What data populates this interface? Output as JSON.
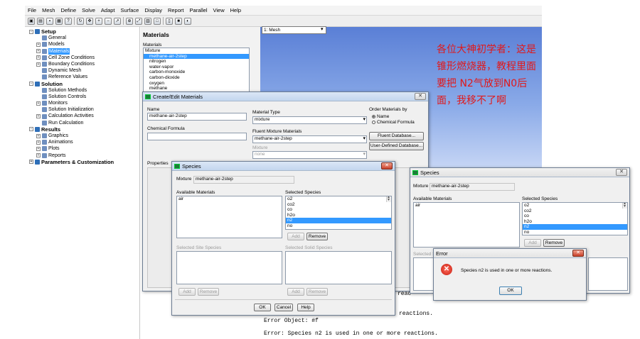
{
  "menubar": [
    "File",
    "Mesh",
    "Define",
    "Solve",
    "Adapt",
    "Surface",
    "Display",
    "Report",
    "Parallel",
    "View",
    "Help"
  ],
  "tree": [
    {
      "label": "Setup",
      "bold": true,
      "expander": "-",
      "icon": "setup-icon",
      "indent": 0
    },
    {
      "label": "General",
      "bold": false,
      "expander": "",
      "icon": "general-icon",
      "indent": 1
    },
    {
      "label": "Models",
      "bold": false,
      "expander": "+",
      "icon": "models-icon",
      "indent": 1
    },
    {
      "label": "Materials",
      "bold": false,
      "expander": "+",
      "icon": "materials-icon",
      "indent": 1,
      "selected": true
    },
    {
      "label": "Cell Zone Conditions",
      "bold": false,
      "expander": "+",
      "icon": "cell-zone-icon",
      "indent": 1
    },
    {
      "label": "Boundary Conditions",
      "bold": false,
      "expander": "+",
      "icon": "boundary-icon",
      "indent": 1
    },
    {
      "label": "Dynamic Mesh",
      "bold": false,
      "expander": "",
      "icon": "dynamic-mesh-icon",
      "indent": 1
    },
    {
      "label": "Reference Values",
      "bold": false,
      "expander": "",
      "icon": "reference-icon",
      "indent": 1
    },
    {
      "label": "Solution",
      "bold": true,
      "expander": "-",
      "icon": "solution-icon",
      "indent": 0
    },
    {
      "label": "Solution Methods",
      "bold": false,
      "expander": "",
      "icon": "methods-icon",
      "indent": 1
    },
    {
      "label": "Solution Controls",
      "bold": false,
      "expander": "",
      "icon": "controls-icon",
      "indent": 1
    },
    {
      "label": "Monitors",
      "bold": false,
      "expander": "+",
      "icon": "monitors-icon",
      "indent": 1
    },
    {
      "label": "Solution Initialization",
      "bold": false,
      "expander": "",
      "icon": "init-icon",
      "indent": 1
    },
    {
      "label": "Calculation Activities",
      "bold": false,
      "expander": "+",
      "icon": "activities-icon",
      "indent": 1
    },
    {
      "label": "Run Calculation",
      "bold": false,
      "expander": "",
      "icon": "run-icon",
      "indent": 1
    },
    {
      "label": "Results",
      "bold": true,
      "expander": "-",
      "icon": "results-icon",
      "indent": 0
    },
    {
      "label": "Graphics",
      "bold": false,
      "expander": "+",
      "icon": "graphics-icon",
      "indent": 1
    },
    {
      "label": "Animations",
      "bold": false,
      "expander": "+",
      "icon": "animations-icon",
      "indent": 1
    },
    {
      "label": "Plots",
      "bold": false,
      "expander": "+",
      "icon": "plots-icon",
      "indent": 1
    },
    {
      "label": "Reports",
      "bold": false,
      "expander": "+",
      "icon": "reports-icon",
      "indent": 1
    },
    {
      "label": "Parameters & Customization",
      "bold": true,
      "expander": "+",
      "icon": "parameters-icon",
      "indent": 0
    }
  ],
  "task": {
    "title": "Materials",
    "section": "Materials",
    "items": [
      "Mixture",
      "methane-air-2step",
      "nitrogen",
      "water-vapor",
      "carbon-monoxide",
      "carbon-dioxide",
      "oxygen",
      "methane"
    ],
    "selected_index": 1
  },
  "graphics": {
    "viewport": "1: Mesh"
  },
  "note": {
    "text": "各位大神初学者：这是锥形燃烧器，教程里面要把 N2气放到N0后面，我移不了啊"
  },
  "create_edit": {
    "title": "Create/Edit Materials",
    "name_label": "Name",
    "name_value": "methane-air-2step",
    "formula_label": "Chemical Formula",
    "formula_value": "",
    "type_label": "Material Type",
    "type_value": "mixture",
    "fluent_label": "Fluent Mixture Materials",
    "fluent_value": "methane-air-2step",
    "mixture_label": "Mixture",
    "mixture_value": "none",
    "order_label": "Order Materials by",
    "order_name": "Name",
    "order_formula": "Chemical Formula",
    "db_button": "Fluent Database...",
    "udf_button": "User-Defined Database...",
    "properties_label": "Properties"
  },
  "species1": {
    "title": "Species",
    "mixture_label": "Mixture",
    "mixture_value": "methane-air-2step",
    "available_label": "Available Materials",
    "available": [
      "air"
    ],
    "selected_label": "Selected Species",
    "selected": [
      "o2",
      "co2",
      "co",
      "h2o",
      "n2",
      "no"
    ],
    "selected_index": 4,
    "add": "Add",
    "remove": "Remove",
    "site_label": "Selected Site Species",
    "solid_label": "Selected Solid Species",
    "ok": "OK",
    "cancel": "Cancel",
    "help": "Help"
  },
  "species2": {
    "title": "Species",
    "mixture_label": "Mixture",
    "mixture_value": "methane-air-2step",
    "available_label": "Available Materials",
    "available": [
      "air"
    ],
    "selected_label": "Selected Species",
    "selected": [
      "o2",
      "co2",
      "co",
      "h2o",
      "n2",
      "no"
    ],
    "selected_index": 4,
    "add": "Add",
    "remove": "Remove",
    "site_label": "Selected S"
  },
  "error": {
    "title": "Error",
    "message": "Species n2 is used in one or more reactions.",
    "ok": "OK"
  },
  "console": {
    "lines": [
      "reac",
      "reactions.",
      "Error Object: #f",
      "Error: Species n2 is used in one or more reactions."
    ]
  }
}
